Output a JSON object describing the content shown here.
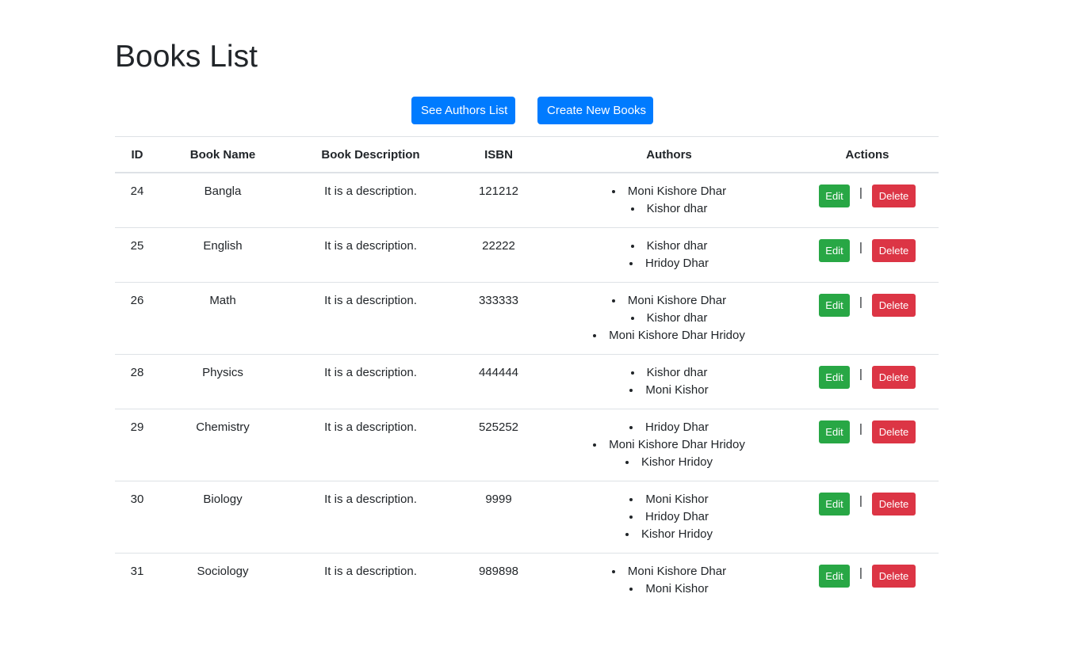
{
  "page": {
    "title": "Books List"
  },
  "toolbar": {
    "authors_label": "See Authors List",
    "create_label": "Create New Books"
  },
  "table": {
    "headers": [
      "ID",
      "Book Name",
      "Book Description",
      "ISBN",
      "Authors",
      "Actions"
    ],
    "rows": [
      {
        "id": "24",
        "name": "Bangla",
        "description": "It is a description.",
        "isbn": "121212",
        "authors": [
          "Moni Kishore Dhar",
          "Kishor dhar"
        ]
      },
      {
        "id": "25",
        "name": "English",
        "description": "It is a description.",
        "isbn": "22222",
        "authors": [
          "Kishor dhar",
          "Hridoy Dhar"
        ]
      },
      {
        "id": "26",
        "name": "Math",
        "description": "It is a description.",
        "isbn": "333333",
        "authors": [
          "Moni Kishore Dhar",
          "Kishor dhar",
          "Moni Kishore Dhar Hridoy"
        ]
      },
      {
        "id": "28",
        "name": "Physics",
        "description": "It is a description.",
        "isbn": "444444",
        "authors": [
          "Kishor dhar",
          "Moni Kishor"
        ]
      },
      {
        "id": "29",
        "name": "Chemistry",
        "description": "It is a description.",
        "isbn": "525252",
        "authors": [
          "Hridoy Dhar",
          "Moni Kishore Dhar Hridoy",
          "Kishor Hridoy"
        ]
      },
      {
        "id": "30",
        "name": "Biology",
        "description": "It is a description.",
        "isbn": "9999",
        "authors": [
          "Moni Kishor",
          "Hridoy Dhar",
          "Kishor Hridoy"
        ]
      },
      {
        "id": "31",
        "name": "Sociology",
        "description": "It is a description.",
        "isbn": "989898",
        "authors": [
          "Moni Kishore Dhar",
          "Moni Kishor"
        ]
      }
    ],
    "actions": {
      "edit_label": "Edit",
      "separator": "|",
      "delete_label": "Delete"
    }
  },
  "colors": {
    "primary": "#007bff",
    "success": "#28a745",
    "danger": "#dc3545"
  }
}
